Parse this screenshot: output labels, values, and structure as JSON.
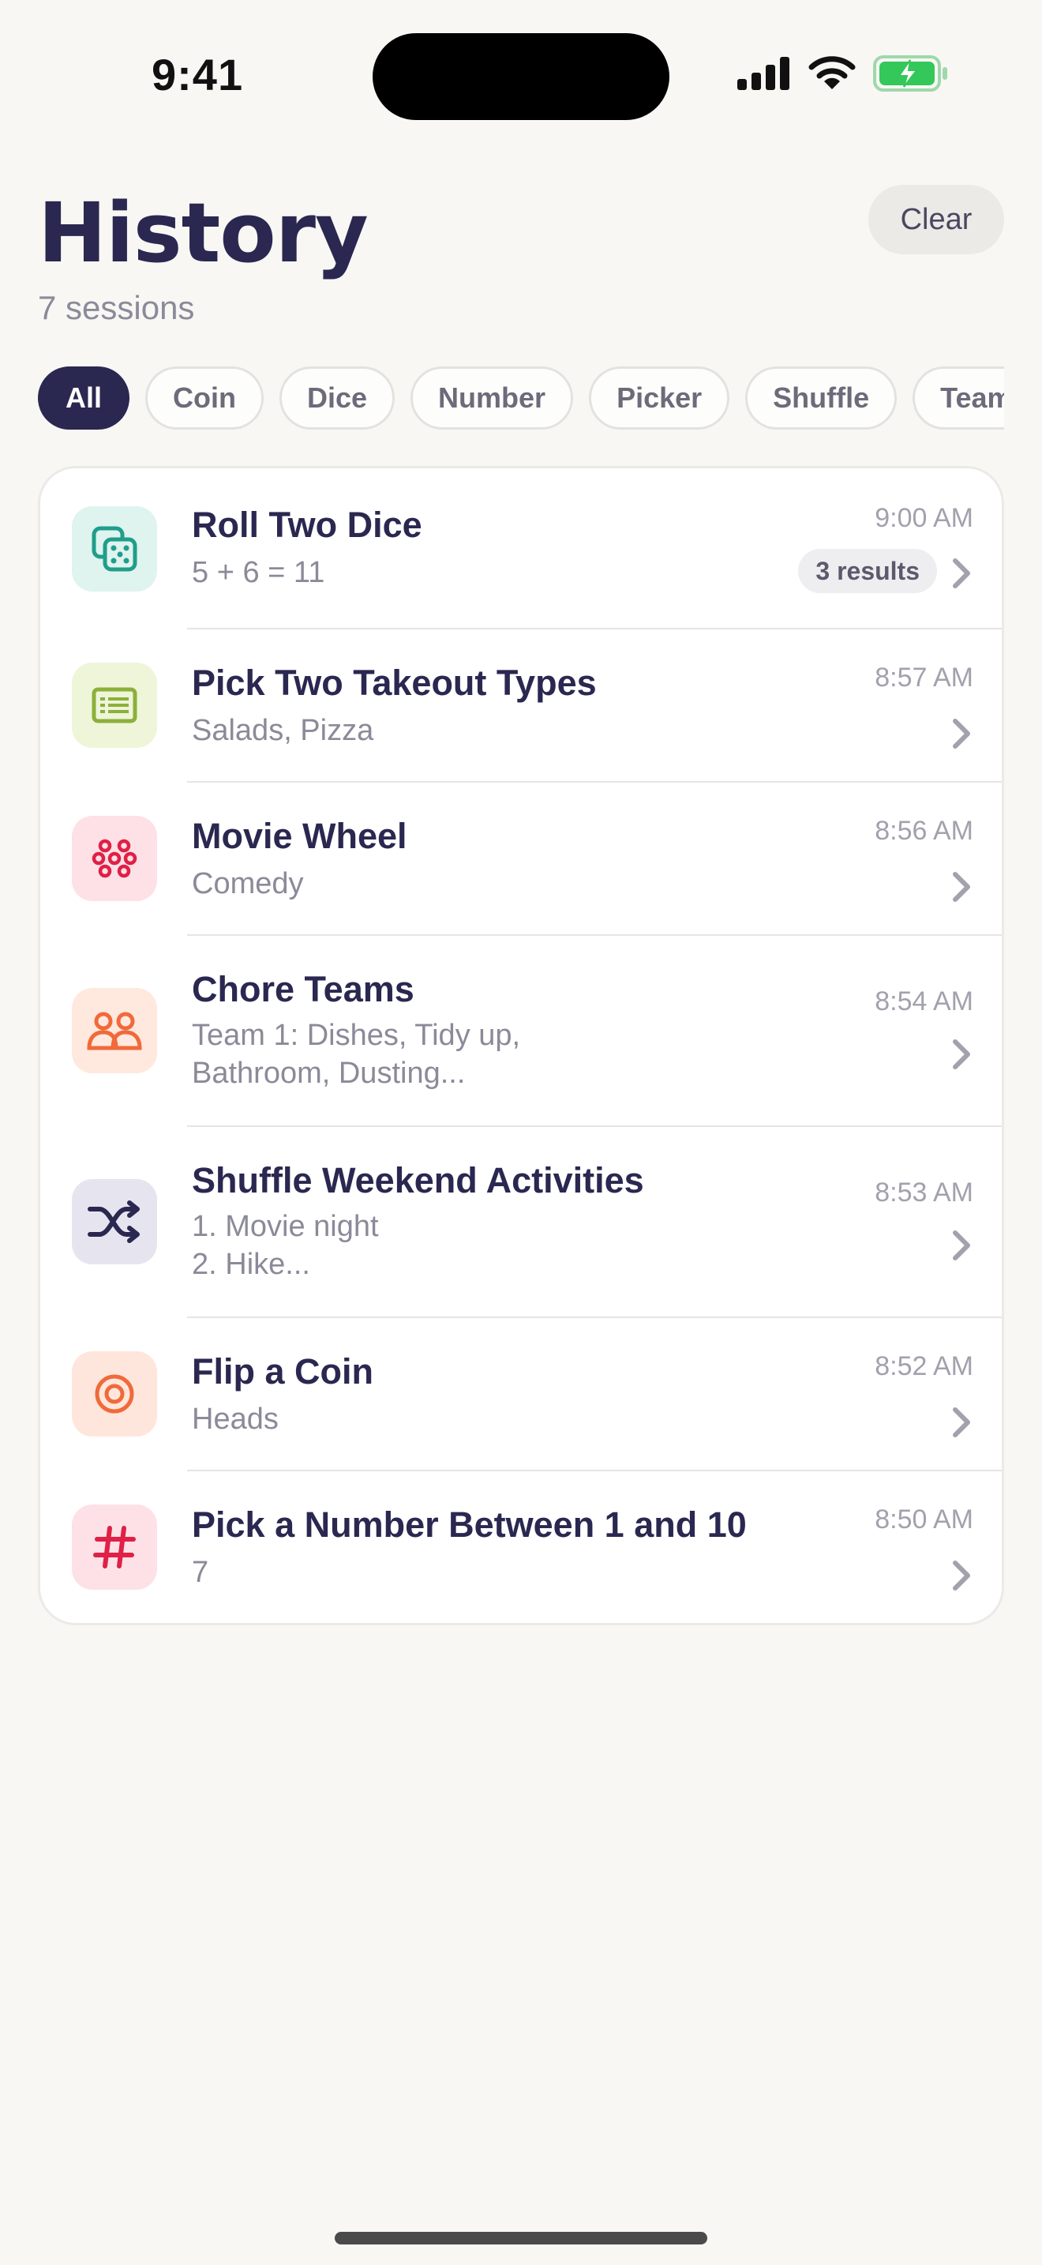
{
  "status_bar": {
    "time": "9:41"
  },
  "header": {
    "title": "History",
    "subtitle": "7 sessions",
    "clear_label": "Clear"
  },
  "filters": [
    "All",
    "Coin",
    "Dice",
    "Number",
    "Picker",
    "Shuffle",
    "Teams"
  ],
  "active_filter": "All",
  "colors": {
    "accent": "#2a2850",
    "battery": "#34c759"
  },
  "sessions": [
    {
      "icon": "dice-icon",
      "title": "Roll Two Dice",
      "subtitle": "5 + 6 = 11",
      "time": "9:00 AM",
      "badge": "3 results",
      "icon_bg": "#dff3ef",
      "icon_color": "#1f9e8a"
    },
    {
      "icon": "list-icon",
      "title": "Pick Two Takeout Types",
      "subtitle": "Salads, Pizza",
      "time": "8:57 AM",
      "icon_bg": "#eef5d9",
      "icon_color": "#8cb03a"
    },
    {
      "icon": "wheel-icon",
      "title": "Movie Wheel",
      "subtitle": "Comedy",
      "time": "8:56 AM",
      "icon_bg": "#fde1e6",
      "icon_color": "#e02046"
    },
    {
      "icon": "people-icon",
      "title": "Chore Teams",
      "subtitle": "Team 1: Dishes, Tidy up,\nBathroom, Dusting...",
      "time": "8:54 AM",
      "icon_bg": "#ffe8de",
      "icon_color": "#f06a3a"
    },
    {
      "icon": "shuffle-icon",
      "title": "Shuffle Weekend Activities",
      "subtitle": "1. Movie night\n2. Hike...",
      "time": "8:53 AM",
      "icon_bg": "#e6e5ef",
      "icon_color": "#2a2850"
    },
    {
      "icon": "target-icon",
      "title": "Flip a Coin",
      "subtitle": "Heads",
      "time": "8:52 AM",
      "icon_bg": "#ffe6dc",
      "icon_color": "#f06a3a"
    },
    {
      "icon": "hash-icon",
      "title": "Pick a Number Between 1 and 10",
      "subtitle": "7",
      "time": "8:50 AM",
      "icon_bg": "#fde1e6",
      "icon_color": "#e02046"
    }
  ]
}
